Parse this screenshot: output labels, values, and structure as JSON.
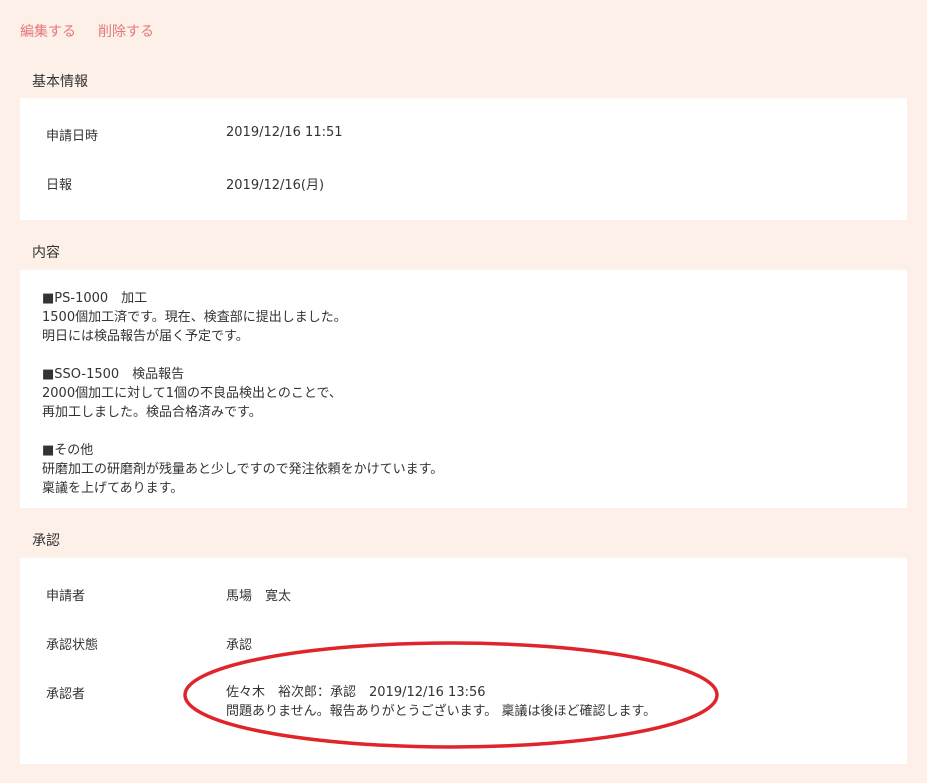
{
  "actions": {
    "edit": "編集する",
    "delete": "削除する"
  },
  "basic_info": {
    "title": "基本情報",
    "rows": [
      {
        "label": "申請日時",
        "value": "2019/12/16 11:51"
      },
      {
        "label": "日報",
        "value": "2019/12/16(月)"
      }
    ]
  },
  "content": {
    "title": "内容",
    "text": "■PS-1000　加工\n1500個加工済です。現在、検査部に提出しました。\n明日には検品報告が届く予定です。\n\n■SSO-1500　検品報告\n2000個加工に対して1個の不良品検出とのことで、\n再加工しました。検品合格済みです。\n\n■その他\n研磨加工の研磨剤が残量あと少しですので発注依頼をかけています。\n稟議を上げてあります。"
  },
  "approval": {
    "title": "承認",
    "applicant_label": "申請者",
    "applicant_value": "馬場　寛太",
    "status_label": "承認状態",
    "status_value": "承認",
    "approver_label": "承認者",
    "approver_line1": "佐々木　裕次郎：承認　2019/12/16 13:56",
    "approver_line2": "問題ありません。報告ありがとうございます。 稟議は後ほど確認します。"
  },
  "colors": {
    "background": "#fdf0e8",
    "link": "#e5787a",
    "highlight": "#e0242b"
  }
}
